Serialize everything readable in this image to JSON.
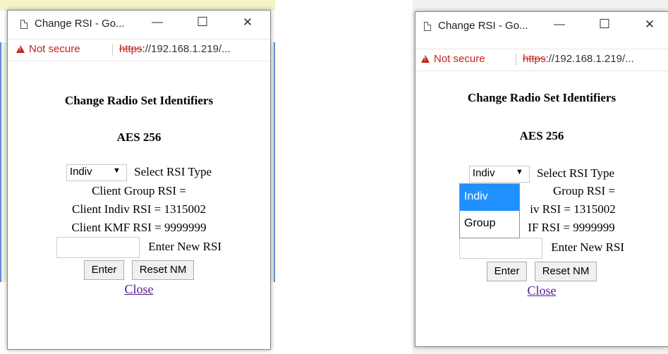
{
  "window": {
    "title": "Change RSI - Go...",
    "controls": {
      "minimize": "—",
      "maximize": "☐",
      "close": "✕"
    }
  },
  "address_bar": {
    "security": "Not secure",
    "url_scheme": "https",
    "url_rest": "://192.168.1.219/..."
  },
  "page": {
    "heading": "Change Radio Set Identifiers",
    "subheading": "AES 256",
    "rsi_type_select": {
      "selected": "Indiv",
      "label": "Select RSI Type"
    },
    "client_group_rsi": "Client Group RSI =",
    "client_indiv_rsi": "Client Indiv RSI = 1315002",
    "client_kmf_rsi": "Client KMF RSI = 9999999",
    "new_rsi_label": "Enter New RSI",
    "enter_button": "Enter",
    "reset_button": "Reset NM",
    "close_link": "Close"
  },
  "dropdown_options": [
    "Indiv",
    "Group"
  ],
  "obscured_text": {
    "group_fragment": "Group RSI =",
    "indiv_fragment": "iv RSI = 1315002",
    "kmf_fragment": "IF RSI = 9999999"
  },
  "colors": {
    "warning": "#c5221f",
    "highlight": "#1e90ff",
    "link": "#551a8b"
  }
}
